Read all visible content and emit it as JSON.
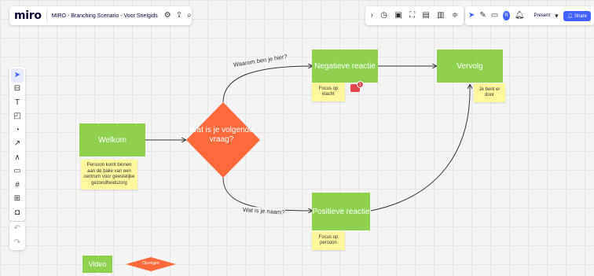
{
  "app": {
    "logo": "miro",
    "board_title": "MIRO - Branching Scenario - Voor Snelgids",
    "present_label": "Present",
    "share_label": "Share",
    "avatar_initial": "R"
  },
  "colors": {
    "green": "#8fd14f",
    "orange": "#ff6a3d",
    "sticky": "#fef99c",
    "accent": "#4262ff"
  },
  "toolbar_top_left_icons": [
    "gear-icon",
    "upload-icon",
    "search-icon"
  ],
  "toolbar_top_right_icons": [
    "chevron-right-icon",
    "timer-icon",
    "frame-icon",
    "focus-icon",
    "card-icon",
    "doc-icon",
    "more-icon"
  ],
  "toolbar_collab_icons": [
    "pointer-icon",
    "reaction-icon",
    "comment-icon",
    "bell-icon"
  ],
  "sidebar_tools": [
    "select-tool",
    "template-tool",
    "text-tool",
    "sticky-tool",
    "shape-tool",
    "pen-tool",
    "connection-tool",
    "comment-tool",
    "frame-tool",
    "upload-tool",
    "more-tool"
  ],
  "canvas": {
    "welkom": "Welkom",
    "welkom_sticky": "Persoon komt binnen aan de balie van een centrum voor geestelijke gezondheidszorg",
    "question": "Wat is je volgende vraag?",
    "negatieve": "Negatieve reactie",
    "negatieve_sticky": "Focus op klacht",
    "comment_count": "1",
    "positieve": "Positieve reactie",
    "positieve_sticky": "Focus op persoon",
    "vervolg": "Vervolg",
    "vervolg_sticky": "Je bent er door",
    "label_top": "Waarom ben je hier?",
    "label_bottom": "Wat is je naam?",
    "video": "Video",
    "opvolgen": "Opvolgen"
  }
}
